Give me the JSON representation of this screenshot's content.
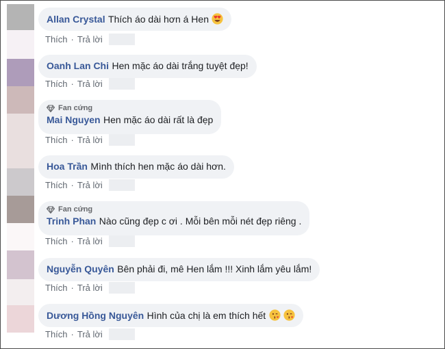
{
  "comments": [
    {
      "author": "Allan Crystal",
      "text": "Thích áo dài hơn á Hen",
      "emojis": [
        "heart-eyes"
      ],
      "fan": false,
      "like": "Thích",
      "reply": "Trả lời"
    },
    {
      "author": "Oanh Lan Chi",
      "text": "Hen mặc áo dài trắng tuyệt đẹp!",
      "fan": false,
      "like": "Thích",
      "reply": "Trả lời"
    },
    {
      "author": "Mai Nguyen",
      "text": "Hen mặc áo dài rất là đẹp",
      "fan": true,
      "badge": "Fan cứng",
      "like": "Thích",
      "reply": "Trả lời"
    },
    {
      "author": "Hoa Trần",
      "text": "Mình thích hen mặc áo dài hơn.",
      "fan": false,
      "like": "Thích",
      "reply": "Trả lời"
    },
    {
      "author": "Trinh Phan",
      "text": "Nào cũng đẹp c ơi . Mỗi bên mỗi nét đẹp riêng .",
      "fan": true,
      "badge": "Fan cứng",
      "like": "Thích",
      "reply": "Trả lời"
    },
    {
      "author": "Nguyễn Quyên",
      "text": "Bên phải đi, mê Hen lắm !!! Xinh lắm yêu lắm!",
      "fan": false,
      "like": "Thích",
      "reply": "Trả lời"
    },
    {
      "author": "Dương Hồng Nguyên",
      "text": "Hình của chị là em thích hết",
      "emojis": [
        "kiss-face",
        "kiss-face"
      ],
      "fan": false,
      "like": "Thích",
      "reply": "Trả lời"
    }
  ],
  "colors": {
    "author": "#385898",
    "bubble": "#f0f2f5",
    "meta": "#606770"
  }
}
